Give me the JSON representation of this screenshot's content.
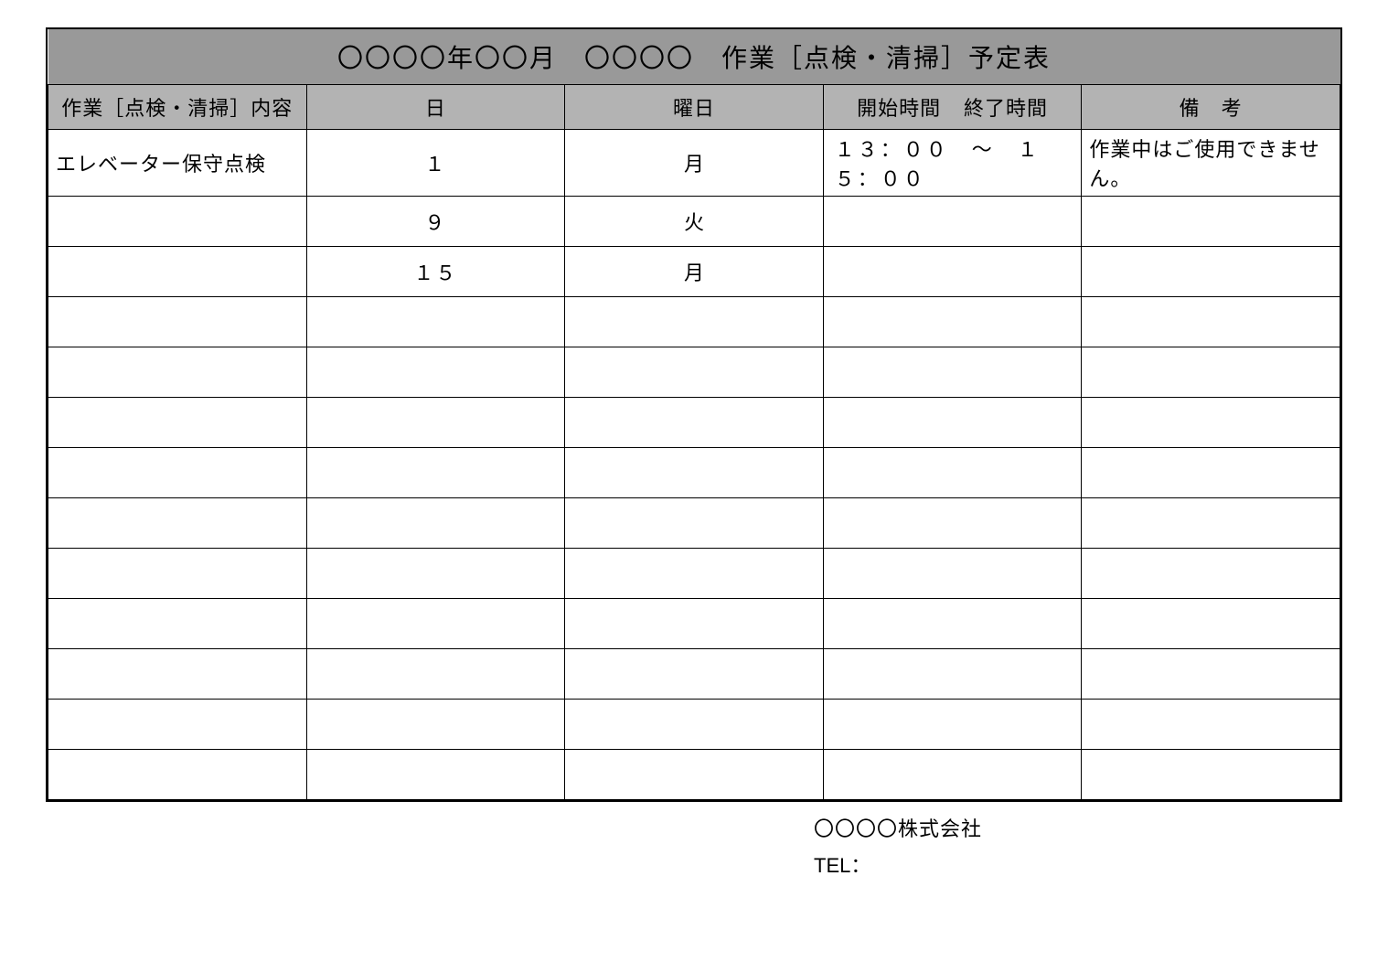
{
  "title": "〇〇〇〇年〇〇月　〇〇〇〇　作業［点検・清掃］予定表",
  "headers": {
    "content": "作業［点検・清掃］内容",
    "day": "日",
    "dow": "曜日",
    "start_time": "開始時間",
    "end_time": "終了時間",
    "note": "備　考"
  },
  "rows": [
    {
      "content": "エレベーター保守点検",
      "day": "１",
      "dow": "月",
      "time": "１３：００　～　１５：００",
      "note": "作業中はご使用できません。"
    },
    {
      "content": "",
      "day": "９",
      "dow": "火",
      "time": "",
      "note": ""
    },
    {
      "content": "",
      "day": "１５",
      "dow": "月",
      "time": "",
      "note": ""
    },
    {
      "content": "",
      "day": "",
      "dow": "",
      "time": "",
      "note": ""
    },
    {
      "content": "",
      "day": "",
      "dow": "",
      "time": "",
      "note": ""
    },
    {
      "content": "",
      "day": "",
      "dow": "",
      "time": "",
      "note": ""
    },
    {
      "content": "",
      "day": "",
      "dow": "",
      "time": "",
      "note": ""
    },
    {
      "content": "",
      "day": "",
      "dow": "",
      "time": "",
      "note": ""
    },
    {
      "content": "",
      "day": "",
      "dow": "",
      "time": "",
      "note": ""
    },
    {
      "content": "",
      "day": "",
      "dow": "",
      "time": "",
      "note": ""
    },
    {
      "content": "",
      "day": "",
      "dow": "",
      "time": "",
      "note": ""
    },
    {
      "content": "",
      "day": "",
      "dow": "",
      "time": "",
      "note": ""
    },
    {
      "content": "",
      "day": "",
      "dow": "",
      "time": "",
      "note": ""
    }
  ],
  "footer": {
    "company": "〇〇〇〇株式会社",
    "tel_label": "TEL：",
    "tel_value": ""
  }
}
